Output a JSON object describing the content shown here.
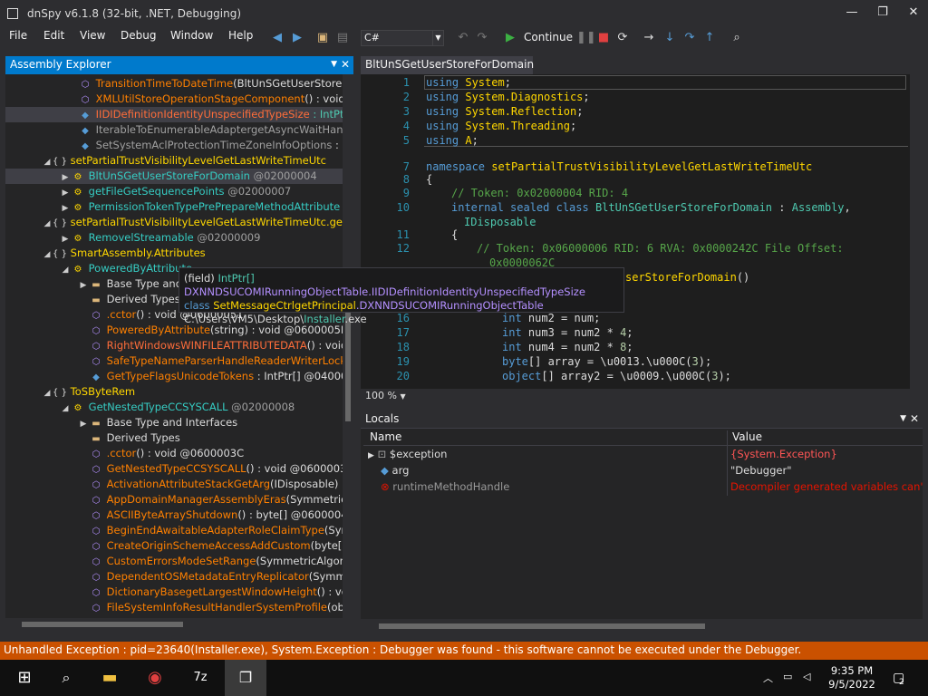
{
  "window": {
    "title": "dnSpy v6.1.8 (32-bit, .NET, Debugging)"
  },
  "menu": [
    "File",
    "Edit",
    "View",
    "Debug",
    "Window",
    "Help"
  ],
  "toolbar": {
    "language": "C#",
    "continue_label": "Continue"
  },
  "explorer": {
    "title": "Assembly Explorer",
    "nodes": [
      {
        "name": "TransitionTimeToDateTime",
        "params": "(BltUnSGetUserStoreF"
      },
      {
        "name": "XMLUtilStoreOperationStageComponent",
        "params": "() : void"
      },
      {
        "name": "IIDIDefinitionIdentityUnspecifiedTypeSize",
        "params": " : IntPtr"
      },
      {
        "name": "IterableToEnumerableAdaptergetAsyncWaitHand",
        "params": ""
      },
      {
        "name": "SetSystemAclProtectionTimeZoneInfoOptions",
        "params": " : I"
      },
      {
        "name": "setPartialTrustVisibilityLevelGetLastWriteTimeUtc",
        "params": ""
      },
      {
        "name": "BltUnSGetUserStoreForDomain",
        "params": " @02000004"
      },
      {
        "name": "getFileGetSequencePoints",
        "params": " @02000007"
      },
      {
        "name": "PermissionTokenTypePrePrepareMethodAttribute",
        "params": " @"
      },
      {
        "name": "setPartialTrustVisibilityLevelGetLastWriteTimeUtc.getExp",
        "params": ""
      },
      {
        "name": "RemovelStreamable",
        "params": " @02000009"
      },
      {
        "name": "SmartAssembly.Attributes",
        "params": ""
      },
      {
        "name": "PoweredByAttribute",
        "params": ""
      },
      {
        "name": "Base Type and Interfaces",
        "params": ""
      },
      {
        "name": "Derived Types",
        "params": ""
      },
      {
        "name": ".cctor",
        "params": "() : void @06000051"
      },
      {
        "name": "PoweredByAttribute",
        "params": "(string) : void @0600005E"
      },
      {
        "name": "RightWindowsWINFILEATTRIBUTEDATA",
        "params": "() : void @"
      },
      {
        "name": "SafeTypeNameParserHandleReaderWriterLockTim",
        "params": ""
      },
      {
        "name": "GetTypeFlagsUnicodeTokens",
        "params": " : IntPtr[] @0400001"
      },
      {
        "name": "ToSByteRem",
        "params": ""
      },
      {
        "name": "GetNestedTypeCCSYSCALL",
        "params": " @02000008"
      },
      {
        "name": "Base Type and Interfaces",
        "params": ""
      },
      {
        "name": "Derived Types",
        "params": ""
      },
      {
        "name": ".cctor",
        "params": "() : void @0600003C"
      },
      {
        "name": "GetNestedTypeCCSYSCALL",
        "params": "() : void @0600003B"
      },
      {
        "name": "ActivationAttributeStackGetArg",
        "params": "(IDisposable) : vo"
      },
      {
        "name": "AppDomainManagerAssemblyEras",
        "params": "(SymmetricA"
      },
      {
        "name": "ASCIIByteArrayShutdown",
        "params": "() : byte[] @06000041"
      },
      {
        "name": "BeginEndAwaitableAdapterRoleClaimType",
        "params": "(Symm"
      },
      {
        "name": "CreateOriginSchemeAccessAddCustom",
        "params": "(byte[]) :"
      },
      {
        "name": "CustomErrorsModeSetRange",
        "params": "(SymmetricAlgorith"
      },
      {
        "name": "DependentOSMetadataEntryReplicator",
        "params": "(Symmetri"
      },
      {
        "name": "DictionaryBasegetLargestWindowHeight",
        "params": "() : void"
      },
      {
        "name": "FileSystemInfoResultHandlerSystemProfile",
        "params": "(obje"
      }
    ]
  },
  "tooltip": {
    "line1_prefix": "(field) ",
    "line1_type": "IntPtr[]",
    "line1_class": "DXNNDSUCOMIRunningObjectTable",
    "line1_member": ".IIDIDefinitionIdentityUnspecifiedTypeSize",
    "line2_kw": "class ",
    "line2_ns": "SetMessageCtrlgetPrincipal",
    "line2_class": ".DXNNDSUCOMIRunningObjectTable",
    "line3_path": "C:\\Users\\VM5\\Desktop\\",
    "line3_file": "Installer",
    "line3_ext": ".exe"
  },
  "editor": {
    "tab": "BltUnSGetUserStoreForDomain",
    "zoom": "100 %",
    "lines": [
      {
        "n": "1",
        "code": "using System;"
      },
      {
        "n": "2",
        "code": "using System.Diagnostics;"
      },
      {
        "n": "3",
        "code": "using System.Reflection;"
      },
      {
        "n": "4",
        "code": "using System.Threading;"
      },
      {
        "n": "5",
        "code": "using A;"
      },
      {
        "n": "7",
        "code": "namespace setPartialTrustVisibilityLevelGetLastWriteTimeUtc"
      },
      {
        "n": "8",
        "code": "{"
      },
      {
        "n": "9",
        "code": "// Token: 0x02000004 RID: 4"
      },
      {
        "n": "10",
        "code": "internal sealed class BltUnSGetUserStoreForDomain : Assembly,"
      },
      {
        "n": "",
        "code": "IDisposable"
      },
      {
        "n": "11",
        "code": "{"
      },
      {
        "n": "12",
        "code": "// Token: 0x06000006 RID: 6 RVA: 0x0000242C File Offset:"
      },
      {
        "n": "",
        "code": "0x0000062C"
      },
      {
        "n": "",
        "code": "serStoreForDomain()"
      },
      {
        "n": "16",
        "code": "int num2 = num;"
      },
      {
        "n": "17",
        "code": "int num3 = num2 * 4;"
      },
      {
        "n": "18",
        "code": "int num4 = num2 * 8;"
      },
      {
        "n": "19",
        "code": "byte[] array = \\u0013.\\u000C(3);"
      },
      {
        "n": "20",
        "code": "object[] array2 = \\u0009.\\u000C(3);"
      }
    ]
  },
  "locals": {
    "title": "Locals",
    "col_name": "Name",
    "col_value": "Value",
    "rows": [
      {
        "name": "$exception",
        "value": "{System.Exception}"
      },
      {
        "name": "arg",
        "value": "\"Debugger\""
      },
      {
        "name": "runtimeMethodHandle",
        "value": "Decompiler generated variables can't be"
      }
    ]
  },
  "status": {
    "text": "Unhandled Exception : pid=23640(Installer.exe), System.Exception : Debugger was found - this software cannot be executed under the Debugger."
  },
  "taskbar": {
    "time": "9:35 PM",
    "date": "9/5/2022",
    "notif_count": "2"
  },
  "colors": {
    "accent": "#007acc",
    "status": "#ca5100"
  }
}
